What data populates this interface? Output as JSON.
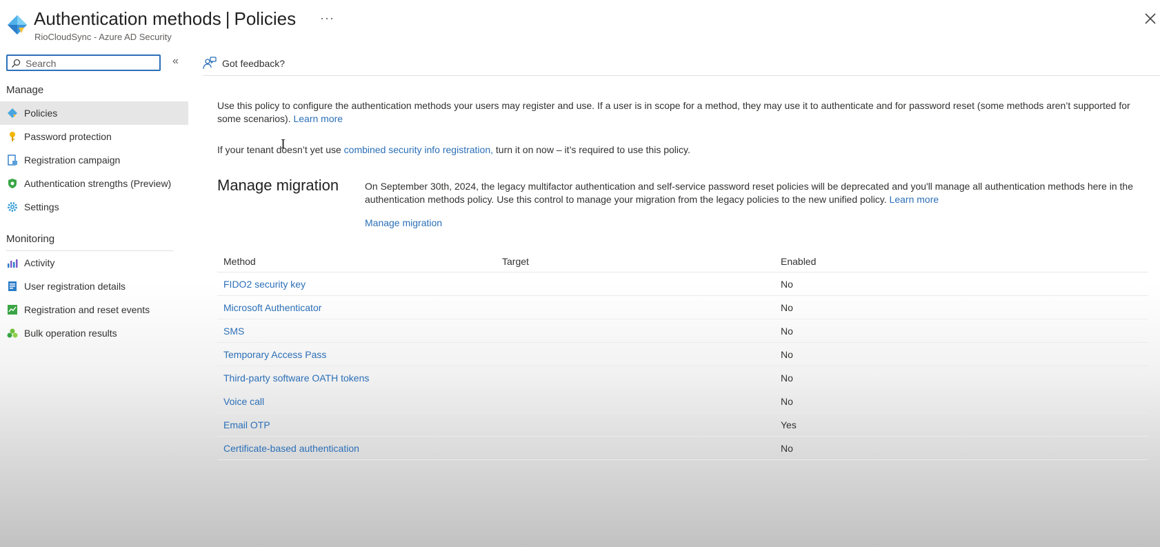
{
  "header": {
    "title_main": "Authentication methods",
    "title_sep": "|",
    "title_page": "Policies",
    "subtitle": "RioCloudSync - Azure AD Security",
    "more_label": "···"
  },
  "sidebar": {
    "search_placeholder": "Search",
    "collapse_label": "«",
    "sections": [
      {
        "title": "Manage",
        "items": [
          {
            "label": "Policies",
            "icon": "diamond-policy-icon",
            "selected": true
          },
          {
            "label": "Password protection",
            "icon": "key-icon"
          },
          {
            "label": "Registration campaign",
            "icon": "campaign-icon"
          },
          {
            "label": "Authentication strengths (Preview)",
            "icon": "shield-icon"
          },
          {
            "label": "Settings",
            "icon": "gear-icon"
          }
        ]
      },
      {
        "title": "Monitoring",
        "items": [
          {
            "label": "Activity",
            "icon": "bar-chart-icon"
          },
          {
            "label": "User registration details",
            "icon": "user-details-icon"
          },
          {
            "label": "Registration and reset events",
            "icon": "events-icon"
          },
          {
            "label": "Bulk operation results",
            "icon": "bulk-results-icon"
          }
        ]
      }
    ]
  },
  "toolbar": {
    "feedback_label": "Got feedback?"
  },
  "intro": {
    "p1_text": "Use this policy to configure the authentication methods your users may register and use. If a user is in scope for a method, they may use it to authenticate and for password reset (some methods aren’t supported for some scenarios).",
    "p1_link": "Learn more",
    "p2_before": "If your tenant doesn’t yet use",
    "p2_link": "combined security info registration,",
    "p2_after": "turn it on now – it’s required to use this policy."
  },
  "migration": {
    "heading": "Manage migration",
    "text": "On September 30th, 2024, the legacy multifactor authentication and self-service password reset policies will be deprecated and you'll manage all authentication methods here in the authentication methods policy. Use this control to manage your migration from the legacy policies to the new unified policy.",
    "learn_more": "Learn more",
    "manage_link": "Manage migration"
  },
  "table": {
    "headers": [
      "Method",
      "Target",
      "Enabled"
    ],
    "rows": [
      {
        "method": "FIDO2 security key",
        "target": "",
        "enabled": "No"
      },
      {
        "method": "Microsoft Authenticator",
        "target": "",
        "enabled": "No"
      },
      {
        "method": "SMS",
        "target": "",
        "enabled": "No"
      },
      {
        "method": "Temporary Access Pass",
        "target": "",
        "enabled": "No"
      },
      {
        "method": "Third-party software OATH tokens",
        "target": "",
        "enabled": "No"
      },
      {
        "method": "Voice call",
        "target": "",
        "enabled": "No"
      },
      {
        "method": "Email OTP",
        "target": "",
        "enabled": "Yes"
      },
      {
        "method": "Certificate-based authentication",
        "target": "",
        "enabled": "No"
      }
    ]
  },
  "colors": {
    "link": "#2b6fb7",
    "selected_bg": "#e6e6e6",
    "text": "#323130"
  }
}
